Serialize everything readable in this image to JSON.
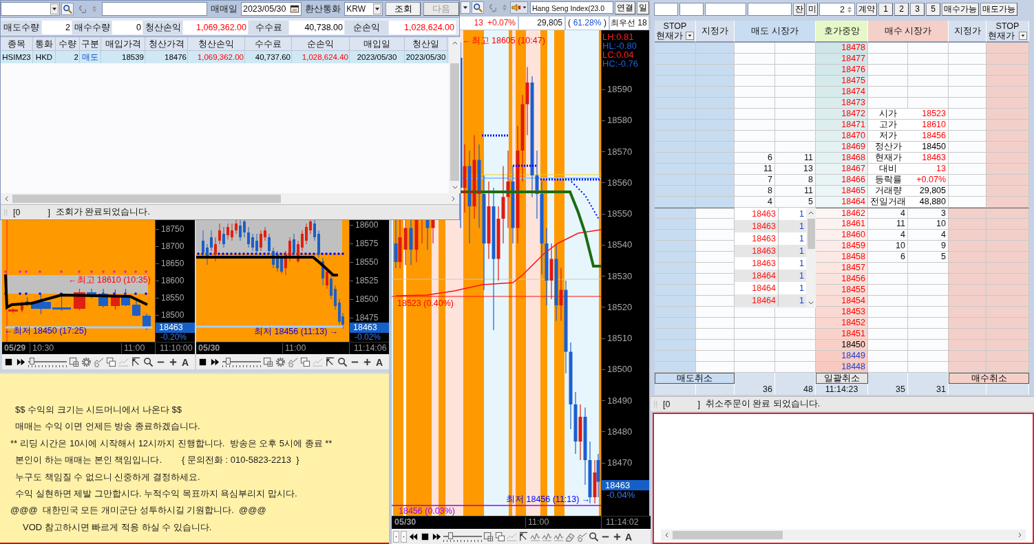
{
  "trade_window": {
    "date_label": "매매일",
    "date_value": "2023/05/30",
    "currency_label": "환산통화",
    "currency_value": "KRW",
    "buttons": [
      {
        "label": "조회",
        "disabled": false
      },
      {
        "label": "다음",
        "disabled": true
      }
    ],
    "summary": [
      {
        "label": "매도수량",
        "value": "2",
        "kind": "plain"
      },
      {
        "label": "매수수량",
        "value": "0",
        "kind": "plain"
      },
      {
        "label": "청산손익",
        "value": "1,069,362.00",
        "kind": "positive"
      },
      {
        "label": "수수료",
        "value": "40,738.00",
        "kind": "plain"
      },
      {
        "label": "순손익",
        "value": "1,028,624.00",
        "kind": "positive"
      }
    ],
    "table": {
      "columns": [
        "종목",
        "통화",
        "수량",
        "구분",
        "매입가격",
        "청산가격",
        "청산손익",
        "수수료",
        "순손익",
        "매입일",
        "청산일"
      ],
      "rows": [
        {
          "cells": [
            {
              "text": "HSIM23",
              "kind": "plain"
            },
            {
              "text": "HKD",
              "kind": "plain"
            },
            {
              "text": "2",
              "kind": "plain"
            },
            {
              "text": "매도",
              "kind": "sell"
            },
            {
              "text": "18539",
              "kind": "plain"
            },
            {
              "text": "18476",
              "kind": "plain"
            },
            {
              "text": "1,069,362.00",
              "kind": "positive"
            },
            {
              "text": "40,737.60",
              "kind": "plain"
            },
            {
              "text": "1,028,624.40",
              "kind": "positive"
            },
            {
              "text": "2023/05/30",
              "kind": "plain"
            },
            {
              "text": "2023/05/30",
              "kind": "plain"
            }
          ]
        }
      ]
    },
    "status": {
      "code": "[0",
      "close": "]",
      "message": "조회가 완료되었습니다."
    }
  },
  "mini_charts": [
    {
      "annotations": [
        {
          "text": "←최고 18610 (10:35)",
          "kind": "high"
        },
        {
          "text": "←최저 18450 (17:25)",
          "kind": "low"
        }
      ],
      "price_ticks": [
        "18750",
        "18700",
        "18650",
        "18600",
        "18550",
        "18500"
      ],
      "current_price": "18463",
      "change": "-0.20%",
      "time_labels": [
        "05/29",
        "10:30",
        "11:00"
      ],
      "clock": "11:10:00",
      "slider": {
        "level": 0.05
      },
      "font_button": "A"
    },
    {
      "annotations": [
        {
          "text": "최저 18456 (11:13) →",
          "kind": "low"
        }
      ],
      "price_ticks": [
        "18600",
        "18575",
        "18550",
        "18525",
        "18500",
        "18475"
      ],
      "current_price": "18463",
      "change": "-0.02%",
      "time_labels": [
        "05/30",
        "11:00"
      ],
      "clock": "11:14:06",
      "slider": {
        "level": 0.1
      },
      "font_button": "A"
    }
  ],
  "notice": {
    "lines": [
      "$$ 수익의 크기는 시드머니에서 나온다 $$",
      "매매는 수익 이면 언제든 방송 종료하겠습니다.",
      "** 리딩 시간은 10시에 시작해서 12시까지 진행합니다.  방송은 오후 5시에 종료 **",
      "본인이 하는 매매는 본인 책임입니다.        { 문의전화 : 010-5823-2213  }",
      "누구도 책임질 수 없으니 신중하게 결정하세요.",
      "수익 실현하면 제발 그만합시다. 누적수익 목표까지 욕심부리지 맙시다.",
      "@@@  대한민국 모든 개미군단 성투하시길 기원합니다.  @@@",
      "VOD 참고하시면 빠르게 적응 하실 수 있습니다."
    ]
  },
  "main_chart": {
    "symbol": "Hang Seng Index(23.0",
    "buttons": [
      "연결",
      "일"
    ],
    "quote": {
      "change": "13",
      "rate": "+0.07%",
      "volume": "29,805",
      "open": "(",
      "ratio": "61.28%",
      "close": ")",
      "best": "최우선 18"
    },
    "stats": [
      {
        "text": "LH:0.81",
        "color": "#ff2020"
      },
      {
        "text": "HL:-0.80",
        "color": "#2060e0"
      },
      {
        "text": "LC:0.04",
        "color": "#ff2020"
      },
      {
        "text": "HC:-0.76",
        "color": "#2060e0"
      }
    ],
    "annotations": [
      {
        "text": "←최고 18605 (10:47)",
        "kind": "high"
      },
      {
        "text": "18523 (0.40%)",
        "kind": "open_line"
      },
      {
        "text": "최저 18456 (11:13) →",
        "kind": "low"
      },
      {
        "text": "18456 (0.03%)",
        "kind": "low_line"
      }
    ],
    "price_ticks": [
      "18590",
      "18580",
      "18570",
      "18560",
      "18550",
      "18540",
      "18530",
      "18520",
      "18510",
      "18500",
      "18490",
      "18480",
      "18470"
    ],
    "current_price": "18463",
    "change": "-0.04%",
    "time_labels": [
      "05/30",
      "11:00"
    ],
    "clock": "11:14:02",
    "slider": {
      "level": 0.15
    },
    "font_button": "A"
  },
  "order_book": {
    "toggle_buttons": [
      "잔",
      "미"
    ],
    "quantity": "2",
    "unit_button": "계약",
    "quick_buttons": [
      "1",
      "2",
      "3",
      "5"
    ],
    "action_buttons": [
      "매수가능",
      "매도가능"
    ],
    "headers": [
      {
        "lines": [
          "STOP",
          "현재가"
        ],
        "kind": "dropdown"
      },
      {
        "lines": [
          "지정가"
        ],
        "kind": "plain"
      },
      {
        "lines": [
          "매도 시장가"
        ],
        "kind": "sell"
      },
      {
        "lines": [
          "호가중앙"
        ],
        "kind": "center"
      },
      {
        "lines": [
          "매수 시장가"
        ],
        "kind": "buy"
      },
      {
        "lines": [
          "지정가"
        ],
        "kind": "plain"
      },
      {
        "lines": [
          "STOP",
          "현재가"
        ],
        "kind": "dropdown"
      }
    ],
    "rows": [
      {
        "kind": "ask",
        "price": "18478",
        "color": "#ff0000"
      },
      {
        "kind": "ask",
        "price": "18477",
        "color": "#ff0000"
      },
      {
        "kind": "ask",
        "price": "18476",
        "color": "#ff0000"
      },
      {
        "kind": "ask",
        "price": "18475",
        "color": "#ff0000"
      },
      {
        "kind": "ask",
        "price": "18474",
        "color": "#ff0000"
      },
      {
        "kind": "ask",
        "price": "18473",
        "color": "#ff0000"
      },
      {
        "kind": "ask",
        "price": "18472",
        "color": "#ff0000",
        "info": {
          "label": "시가",
          "value": "18523",
          "color": "#ff0000"
        }
      },
      {
        "kind": "ask",
        "price": "18471",
        "color": "#ff0000",
        "info": {
          "label": "고가",
          "value": "18610",
          "color": "#ff0000"
        }
      },
      {
        "kind": "ask",
        "price": "18470",
        "color": "#ff0000",
        "info": {
          "label": "저가",
          "value": "18456",
          "color": "#ff0000"
        }
      },
      {
        "kind": "ask",
        "price": "18469",
        "color": "#ff0000",
        "info": {
          "label": "정산가",
          "value": "18450",
          "color": "#000000"
        }
      },
      {
        "kind": "ask",
        "price": "18468",
        "color": "#ff0000",
        "sell": [
          "6",
          "11"
        ],
        "info": {
          "label": "현재가",
          "value": "18463",
          "color": "#ff0000"
        }
      },
      {
        "kind": "ask",
        "price": "18467",
        "color": "#ff0000",
        "sell": [
          "11",
          "13"
        ],
        "info": {
          "label": "대비",
          "value": "13",
          "color": "#ff0000"
        }
      },
      {
        "kind": "ask",
        "price": "18466",
        "color": "#ff0000",
        "sell": [
          "7",
          "8"
        ],
        "info": {
          "label": "등락률",
          "value": "+0.07%",
          "color": "#ff0000"
        }
      },
      {
        "kind": "ask",
        "price": "18465",
        "color": "#ff0000",
        "sell": [
          "8",
          "11"
        ],
        "info": {
          "label": "거래량",
          "value": "29,805",
          "color": "#000000"
        }
      },
      {
        "kind": "ask",
        "price": "18464",
        "color": "#ff0000",
        "sell": [
          "4",
          "5"
        ],
        "info": {
          "label": "전일거래",
          "value": "48,880",
          "color": "#000000"
        }
      },
      {
        "kind": "bid",
        "price": "18462",
        "color": "#ff0000",
        "buy": [
          "4",
          "3"
        ]
      },
      {
        "kind": "bid",
        "price": "18461",
        "color": "#ff0000",
        "buy": [
          "11",
          "10"
        ]
      },
      {
        "kind": "bid",
        "price": "18460",
        "color": "#ff0000",
        "buy": [
          "4",
          "4"
        ]
      },
      {
        "kind": "bid",
        "price": "18459",
        "color": "#ff0000",
        "buy": [
          "10",
          "9"
        ]
      },
      {
        "kind": "bid",
        "price": "18458",
        "color": "#ff0000",
        "buy": [
          "6",
          "5"
        ]
      },
      {
        "kind": "bid",
        "price": "18457",
        "color": "#ff0000"
      },
      {
        "kind": "bid",
        "price": "18456",
        "color": "#ff0000"
      },
      {
        "kind": "bid",
        "price": "18455",
        "color": "#ff0000"
      },
      {
        "kind": "bid",
        "price": "18454",
        "color": "#ff0000"
      },
      {
        "kind": "bid",
        "price": "18453",
        "color": "#ff0000"
      },
      {
        "kind": "bid",
        "price": "18452",
        "color": "#ff0000"
      },
      {
        "kind": "bid",
        "price": "18451",
        "color": "#ff0000"
      },
      {
        "kind": "bid",
        "price": "18450",
        "color": "#000000"
      },
      {
        "kind": "bid",
        "price": "18449",
        "color": "#1a40d0"
      },
      {
        "kind": "bid",
        "price": "18448",
        "color": "#1a40d0"
      }
    ],
    "pending_orders": [
      {
        "price": "18463",
        "qty": "1"
      },
      {
        "price": "18463",
        "qty": "1"
      },
      {
        "price": "18463",
        "qty": "1"
      },
      {
        "price": "18463",
        "qty": "1"
      },
      {
        "price": "18463",
        "qty": "1"
      },
      {
        "price": "18464",
        "qty": "1"
      },
      {
        "price": "18464",
        "qty": "1"
      },
      {
        "price": "18464",
        "qty": "1"
      }
    ],
    "cancel_buttons": [
      {
        "label": "매도취소",
        "kind": "sell"
      },
      {
        "label": "일괄취소",
        "kind": "all"
      },
      {
        "label": "매수취소",
        "kind": "buy"
      }
    ],
    "totals": {
      "sell": [
        "36",
        "48"
      ],
      "time": "11:14:23",
      "buy": [
        "35",
        "31"
      ]
    },
    "status": {
      "code": "[0",
      "close": "]",
      "message": "취소주문이 완료 되었습니다."
    }
  }
}
